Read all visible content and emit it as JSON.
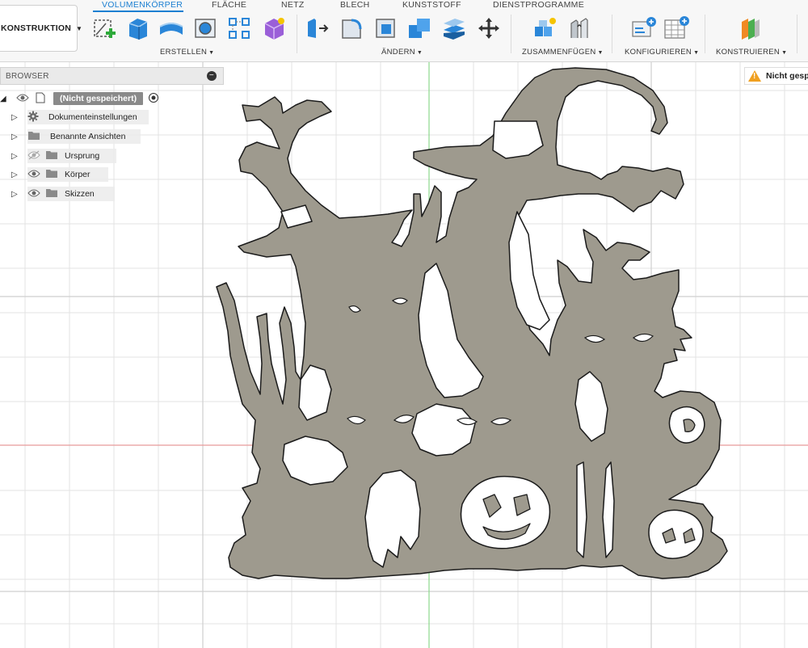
{
  "workspace": {
    "label": "KONSTRUKTION"
  },
  "tabs": [
    {
      "label": "VOLUMENKÖRPER",
      "active": true
    },
    {
      "label": "FLÄCHE"
    },
    {
      "label": "NETZ"
    },
    {
      "label": "BLECH"
    },
    {
      "label": "KUNSTSTOFF"
    },
    {
      "label": "DIENSTPROGRAMME"
    }
  ],
  "groups": {
    "create": "ERSTELLEN",
    "modify": "ÄNDERN",
    "assemble": "ZUSAMMENFÜGEN",
    "configure": "KONFIGURIEREN",
    "construct": "KONSTRUIEREN"
  },
  "browser": {
    "title": "BROWSER",
    "root": "(Nicht gespeichert)",
    "items": [
      {
        "label": "Dokumenteinstellungen",
        "icon": "gear-icon"
      },
      {
        "label": "Benannte Ansichten",
        "icon": "folder-icon"
      },
      {
        "label": "Ursprung",
        "icon": "folder-icon"
      },
      {
        "label": "Körper",
        "icon": "folder-icon"
      },
      {
        "label": "Skizzen",
        "icon": "folder-icon"
      }
    ]
  },
  "warning": {
    "text": "Nicht gesp"
  },
  "colors": {
    "accent": "#1a7fd1",
    "model_fill": "#9e9a8e",
    "grid": "#e3e3e3",
    "axis_x": "#e89a9a",
    "axis_y": "#8cd88c",
    "warning": "#f0a020"
  }
}
